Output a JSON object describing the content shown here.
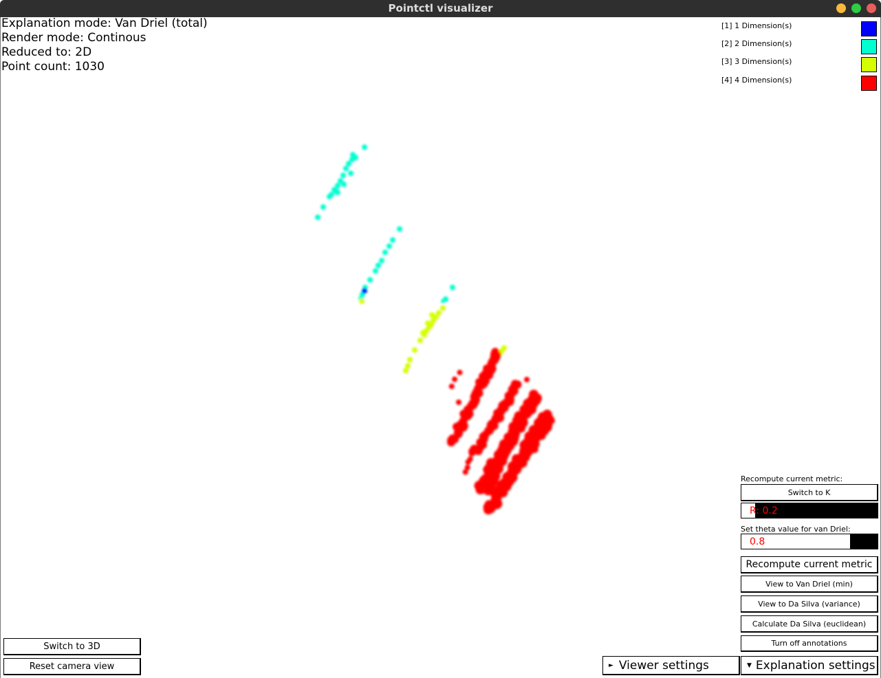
{
  "window": {
    "title": "Pointctl visualizer"
  },
  "info": {
    "explanation_mode": "Explanation mode: Van Driel (total)",
    "render_mode": "Render mode: Continous",
    "reduced_to": "Reduced to: 2D",
    "point_count": "Point count: 1030"
  },
  "legend": [
    {
      "label": "[1] 1 Dimension(s)",
      "color": "#0000ff"
    },
    {
      "label": "[2] 2 Dimension(s)",
      "color": "#00ffd0"
    },
    {
      "label": "[3] 3 Dimension(s)",
      "color": "#d4ff00"
    },
    {
      "label": "[4] 4 Dimension(s)",
      "color": "#ff0000"
    }
  ],
  "panel": {
    "recompute_label": "Recompute current metric:",
    "switch_k": "Switch to K",
    "r_field": {
      "text": "R: 0.2",
      "fill": 0.1
    },
    "theta_label": "Set theta value for van Driel:",
    "theta_field": {
      "text": "0.8",
      "fill": 0.8
    },
    "recompute_button": "Recompute current metric",
    "view_van_driel": "View to Van Driel (min)",
    "view_da_silva": "View to Da Silva (variance)",
    "calc_da_silva": "Calculate Da Silva (euclidean)",
    "turn_off_annotations": "Turn off annotations"
  },
  "bottom_left": {
    "switch_3d": "Switch to 3D",
    "reset_camera": "Reset camera view"
  },
  "tabs": {
    "viewer_settings": "Viewer settings",
    "explanation_settings": "Explanation settings"
  }
}
